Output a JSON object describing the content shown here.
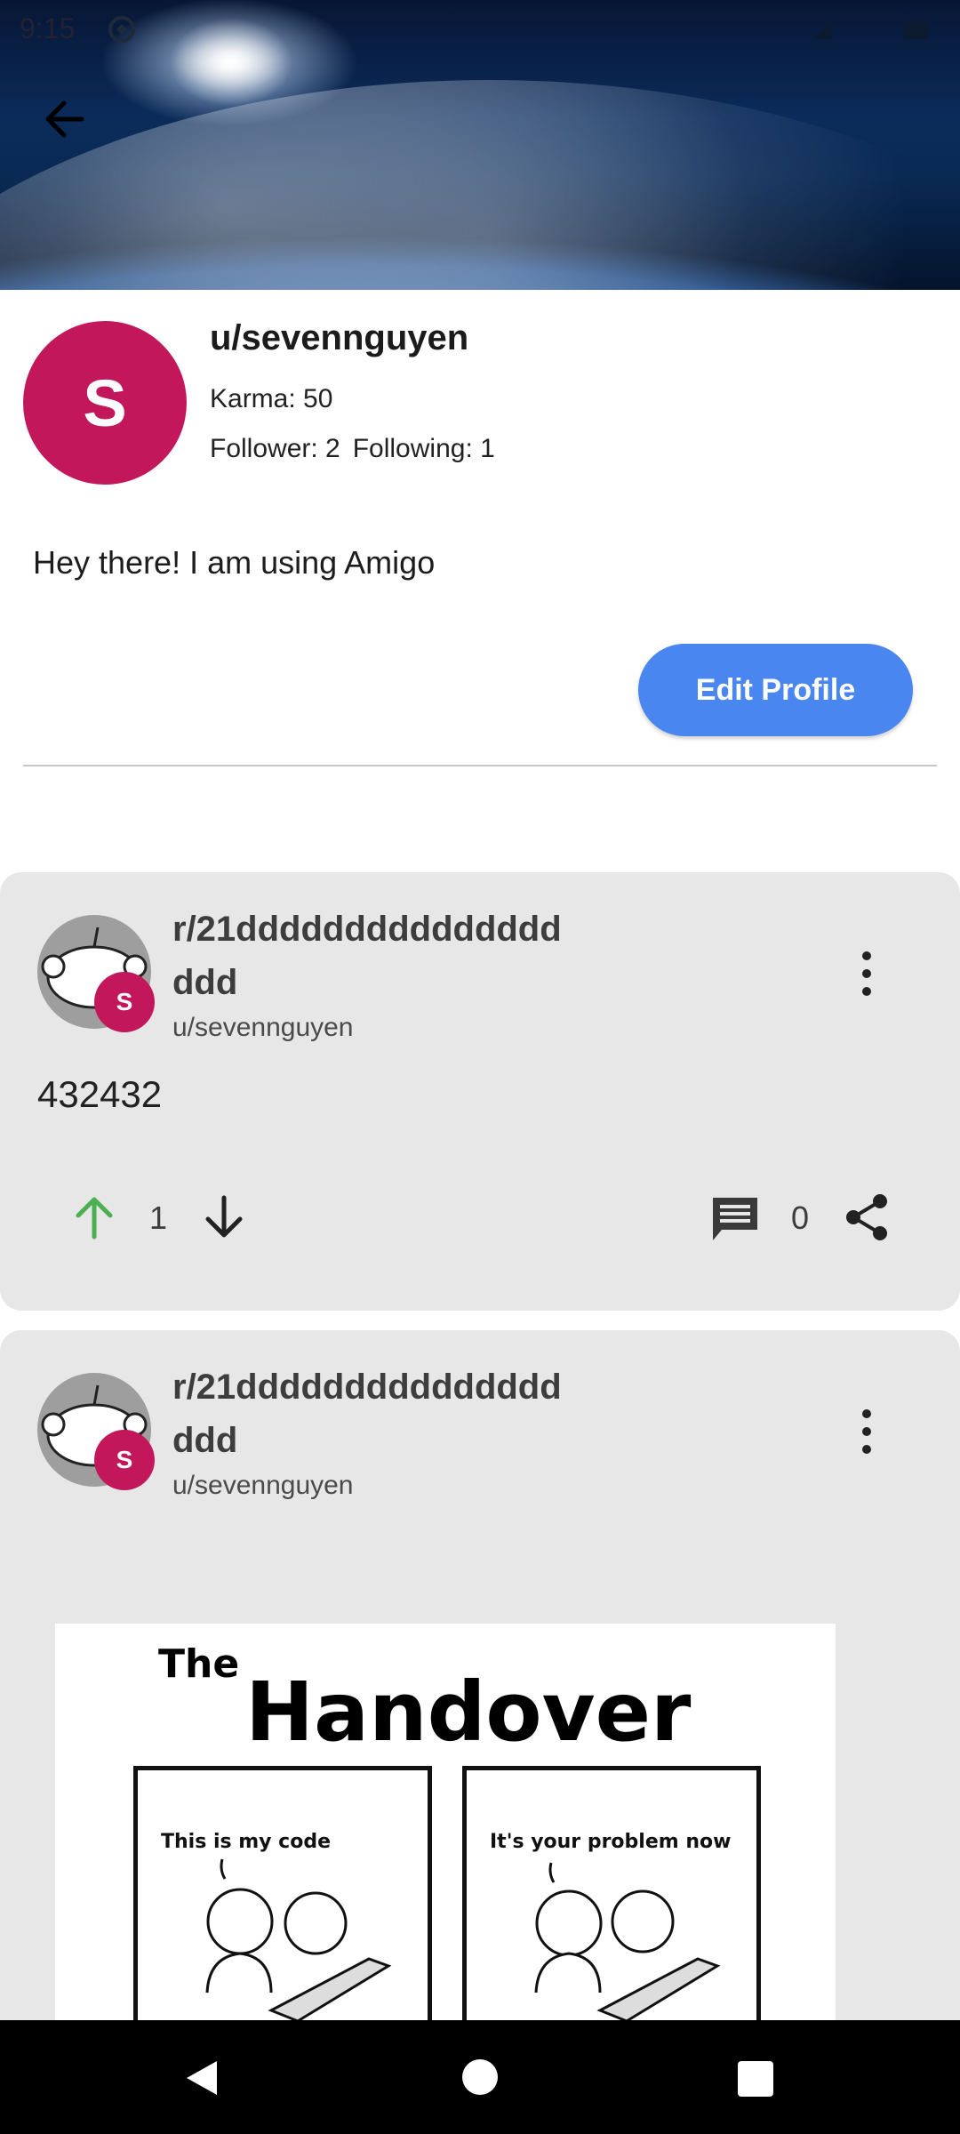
{
  "status": {
    "time": "9:15"
  },
  "profile": {
    "avatar_letter": "S",
    "username": "u/sevennguyen",
    "karma_label": "Karma: 50",
    "follower_label": "Follower: 2",
    "following_label": "Following: 1",
    "bio": "Hey there! I am using Amigo",
    "edit_button": "Edit Profile"
  },
  "posts": [
    {
      "subreddit": "r/21dddddddddddddddddd",
      "author": "u/sevennguyen",
      "badge_letter": "S",
      "text": "432432",
      "votes": "1",
      "comments": "0"
    },
    {
      "subreddit": "r/21dddddddddddddddddd",
      "author": "u/sevennguyen",
      "badge_letter": "S",
      "image": {
        "title_small": "The",
        "title_big": "Handover",
        "caption_left": "This is my code",
        "caption_right": "It's your problem now"
      }
    }
  ],
  "colors": {
    "avatar": "#c2185b",
    "edit_button": "#4a86f0",
    "card_bg": "#e7e7e7",
    "upvote_active": "#4caf50"
  },
  "icons": {
    "back": "arrow-left",
    "more": "vertical-dots",
    "upvote": "arrow-up",
    "downvote": "arrow-down",
    "comment": "speech-bubble",
    "share": "share-nodes"
  }
}
